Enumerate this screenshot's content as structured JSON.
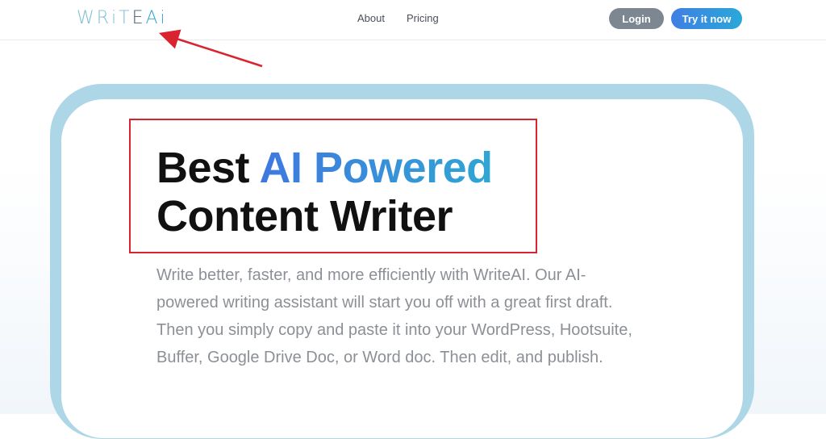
{
  "header": {
    "logo": {
      "part1": "WRiT",
      "part2": "E",
      "part3": "Ai"
    },
    "nav": [
      {
        "label": "About"
      },
      {
        "label": "Pricing"
      }
    ],
    "login_label": "Login",
    "try_label": "Try it now"
  },
  "hero": {
    "headline_start": "Best ",
    "headline_highlight": "AI Powered",
    "headline_end": "Content Writer",
    "description": "Write better, faster, and more efficiently with WriteAI. Our AI-powered writing assistant will start you off with a great first draft. Then you simply copy and paste it into your WordPress, Hootsuite, Buffer, Google Drive Doc, or Word doc. Then edit, and publish."
  },
  "colors": {
    "accent_blue": "#3f7fe4",
    "accent_cyan": "#2aa8d8",
    "frame": "#add6e6",
    "annotation_red": "#d9232e"
  }
}
